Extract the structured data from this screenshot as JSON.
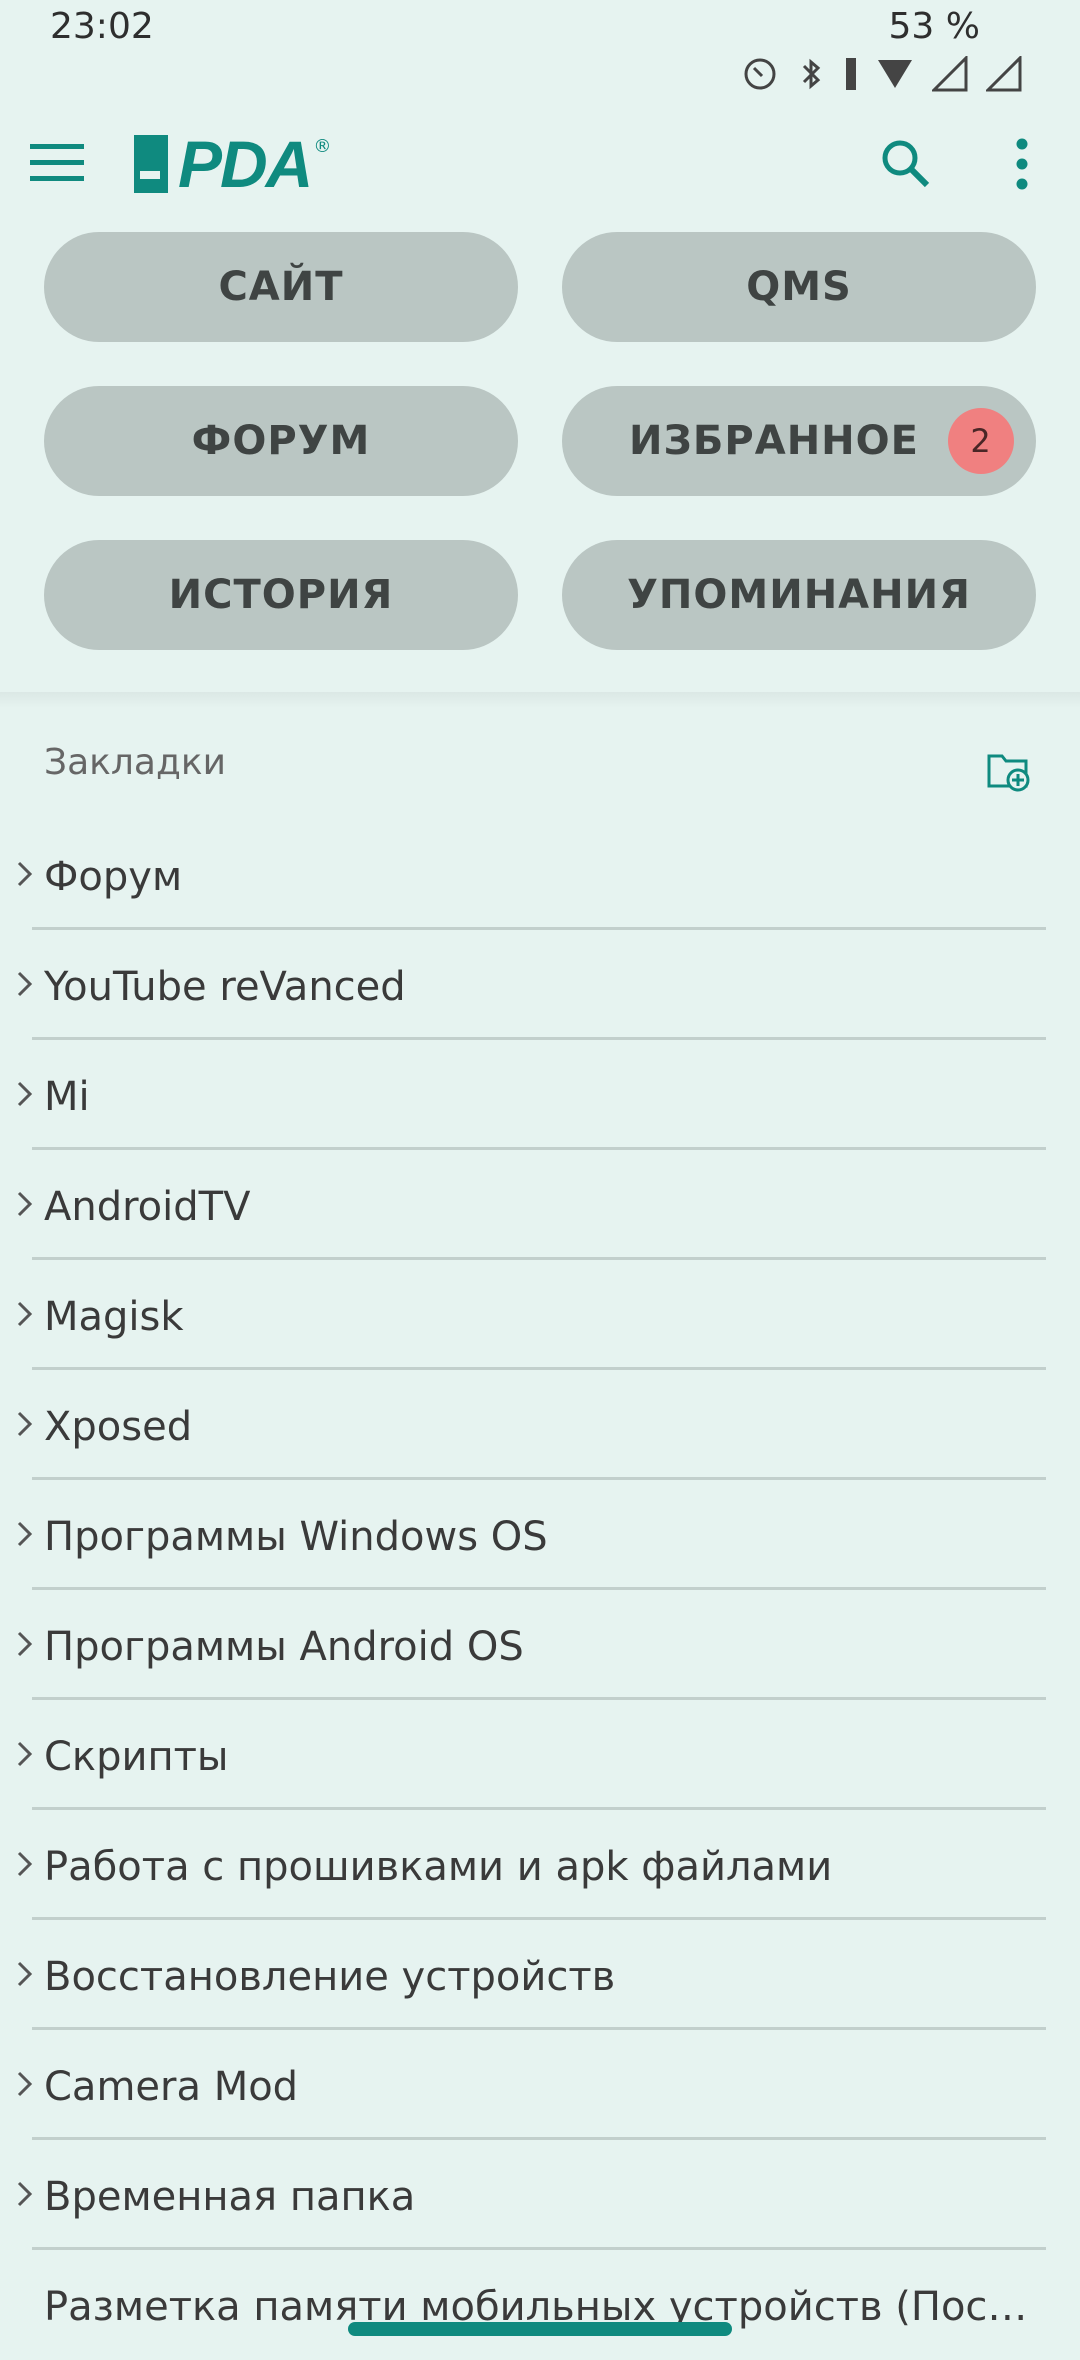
{
  "status_bar": {
    "time": "23:02",
    "battery": "53 %",
    "icons": [
      "alarm-icon",
      "bluetooth-icon",
      "battery-icon",
      "wifi-icon",
      "signal-icon",
      "signal-icon"
    ]
  },
  "app_bar": {
    "logo_text": "PDA",
    "logo_digit": "4"
  },
  "nav_buttons": [
    {
      "label": "САЙТ"
    },
    {
      "label": "QMS"
    },
    {
      "label": "ФОРУМ"
    },
    {
      "label": "ИЗБРАННОЕ",
      "badge": "2"
    },
    {
      "label": "ИСТОРИЯ"
    },
    {
      "label": "УПОМИНАНИЯ"
    }
  ],
  "bookmarks": {
    "title": "Закладки",
    "items": [
      "Форум",
      "YouTube reVanced",
      "Mi",
      "AndroidTV",
      "Magisk",
      "Xposed",
      "Программы Windows OS",
      "Программы Android OS",
      "Скрипты",
      "Работа с прошивками и apk файлами",
      "Восстановление устройств",
      "Camera Mod",
      "Временная папка",
      "Разметка памяти мобильных устройств (Пост г..."
    ]
  },
  "colors": {
    "accent": "#0f8a7f",
    "background": "#e6f3f0",
    "pill": "#bac6c3",
    "badge": "#f08080"
  }
}
